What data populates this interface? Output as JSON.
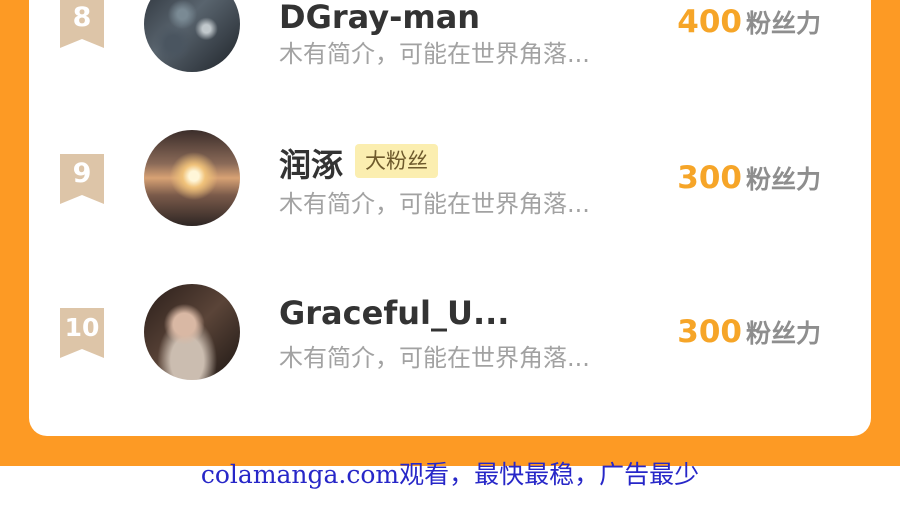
{
  "ranking": {
    "rows": [
      {
        "rank": "8",
        "name": "DGray-man",
        "badge": "",
        "intro": "木有简介，可能在世界角落...",
        "score": "400",
        "score_unit": "粉丝力"
      },
      {
        "rank": "9",
        "name": "润涿",
        "badge": "大粉丝",
        "intro": "木有简介，可能在世界角落...",
        "score": "300",
        "score_unit": "粉丝力"
      },
      {
        "rank": "10",
        "name": "Graceful_U...",
        "badge": "",
        "intro": "木有简介，可能在世界角落...",
        "score": "300",
        "score_unit": "粉丝力"
      }
    ]
  },
  "footer": {
    "text": "colamanga.com观看，最快最稳，广告最少"
  },
  "colors": {
    "frame": "#fd9a24",
    "score": "#f6a528",
    "rank_ribbon": "#ddc5a8",
    "footer": "#2727c8"
  }
}
